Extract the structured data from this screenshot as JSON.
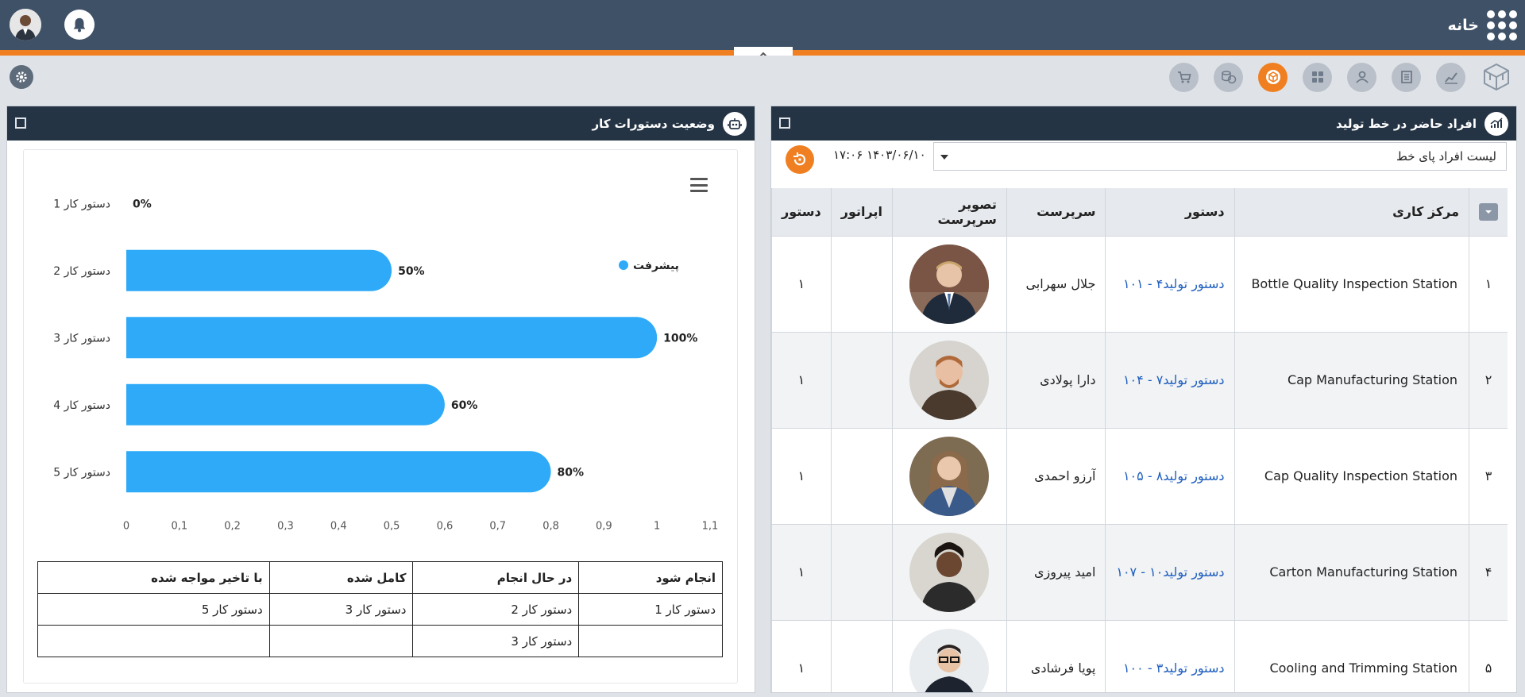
{
  "app": {
    "title": "خانه",
    "accent": "#f07f22",
    "topbar_color": "#3f5167",
    "panel_header_color": "#253445"
  },
  "toolbar": {
    "icons": [
      "logo-cube-icon",
      "chart-line-icon",
      "list-icon",
      "users-icon",
      "grid-icon",
      "box-icon",
      "coins-icon",
      "cart-icon"
    ],
    "active": "box-icon"
  },
  "left_panel": {
    "title": "وضعیت دستورات کار",
    "legend_label": "پیشرفت",
    "status_table": {
      "headers": [
        "انجام شود",
        "در حال انجام",
        "کامل شده",
        "با تاخیر مواجه شده"
      ],
      "rows": [
        [
          "دستور کار 1",
          "دستور کار 2",
          "دستور کار 3",
          "دستور کار 5"
        ],
        [
          "",
          "دستور کار 3",
          "",
          ""
        ]
      ]
    }
  },
  "chart_data": {
    "type": "bar",
    "orientation": "horizontal",
    "categories": [
      "دستور کار 1",
      "دستور کار 2",
      "دستور کار 3",
      "دستور کار 4",
      "دستور کار 5"
    ],
    "series": [
      {
        "name": "پیشرفت",
        "values": [
          0,
          0.5,
          1,
          0.6,
          0.8
        ],
        "color": "#2eaaf8"
      }
    ],
    "data_labels": [
      "0%",
      "50%",
      "100%",
      "60%",
      "80%"
    ],
    "xticks": [
      "0",
      "0,1",
      "0,2",
      "0,3",
      "0,4",
      "0,5",
      "0,6",
      "0,7",
      "0,8",
      "0,9",
      "1",
      "1,1"
    ],
    "xlim": [
      0,
      1.1
    ],
    "grid": false,
    "legend_position": "top-right"
  },
  "right_panel": {
    "title": "افراد حاضر در خط تولید",
    "dropdown_value": "لیست افراد پای خط",
    "timestamp": "۱۴۰۳/۰۶/۱۰ ۱۷:۰۶",
    "columns": [
      "مرکز کاری",
      "دستور",
      "سرپرست",
      "تصویر سرپرست",
      "اپراتور",
      "دستور"
    ],
    "rows": [
      {
        "index": "۱",
        "station": "Bottle Quality Inspection Station",
        "order": "دستور تولید۴ - ۱۰۱",
        "supervisor": "جلال سهرابی",
        "operator": "",
        "count": "۱"
      },
      {
        "index": "۲",
        "station": "Cap Manufacturing Station",
        "order": "دستور تولید۷ - ۱۰۴",
        "supervisor": "دارا پولادی",
        "operator": "",
        "count": "۱"
      },
      {
        "index": "۳",
        "station": "Cap Quality Inspection Station",
        "order": "دستور تولید۸ - ۱۰۵",
        "supervisor": "آرزو احمدی",
        "operator": "",
        "count": "۱"
      },
      {
        "index": "۴",
        "station": "Carton Manufacturing Station",
        "order": "دستور تولید۱۰ - ۱۰۷",
        "supervisor": "امید پیروزی",
        "operator": "",
        "count": "۱"
      },
      {
        "index": "۵",
        "station": "Cooling and Trimming Station",
        "order": "دستور تولید۳ - ۱۰۰",
        "supervisor": "پویا فرشادی",
        "operator": "",
        "count": "۱"
      }
    ]
  }
}
